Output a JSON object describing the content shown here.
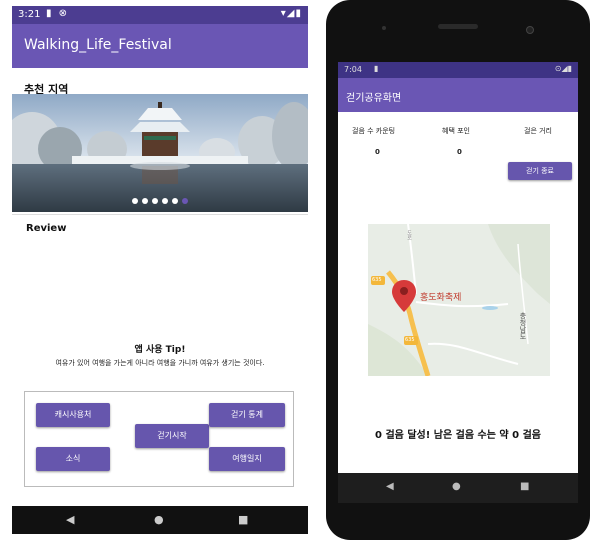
{
  "left_phone": {
    "status": {
      "time": "3:21",
      "icons": "▮ ⊗",
      "right_icons": "▾◢▮"
    },
    "app_title": "Walking_Life_Festival",
    "recommended_title": "추천 지역",
    "review_title": "Review",
    "tip_title": "앱 사용 Tip!",
    "tip_text": "여유가 있어 여행을 가는게 아니라 여행을 가니까 여유가 생기는 것이다.",
    "buttons": {
      "cash": "캐시사용처",
      "walk_start": "걷기시작",
      "walk_stats": "걷기 통계",
      "news": "소식",
      "travel_diary": "여행일지"
    },
    "nav": {
      "back": "◀",
      "home": "●",
      "recent": "■"
    }
  },
  "right_phone": {
    "status": {
      "time": "7:04",
      "icons": "▮",
      "right_icons": "⊙◢▮"
    },
    "app_title": "걷기공유화면",
    "stats": {
      "steps_label": "걸음 수 카운팅",
      "steps_value": "0",
      "benefit_label": "혜택 포인",
      "benefit_value": "0",
      "distance_label": "걸은 거리"
    },
    "end_button": "걷기 종료",
    "map": {
      "place_label": "홍도화축제",
      "region_label": "충청남도",
      "road_number_1": "635",
      "road_number_2": "635",
      "road_vertical": "도로"
    },
    "result": {
      "steps_achieved": "0",
      "steps_achieved_text": "걸음 달성! 남은 걸음 수는 약",
      "remaining": "0",
      "unit": "걸음"
    },
    "nav": {
      "back": "◀",
      "home": "●",
      "recent": "■"
    }
  },
  "colors": {
    "primary": "#6a56b4",
    "primary_dark": "#4c3d91",
    "button": "#6656ad"
  }
}
